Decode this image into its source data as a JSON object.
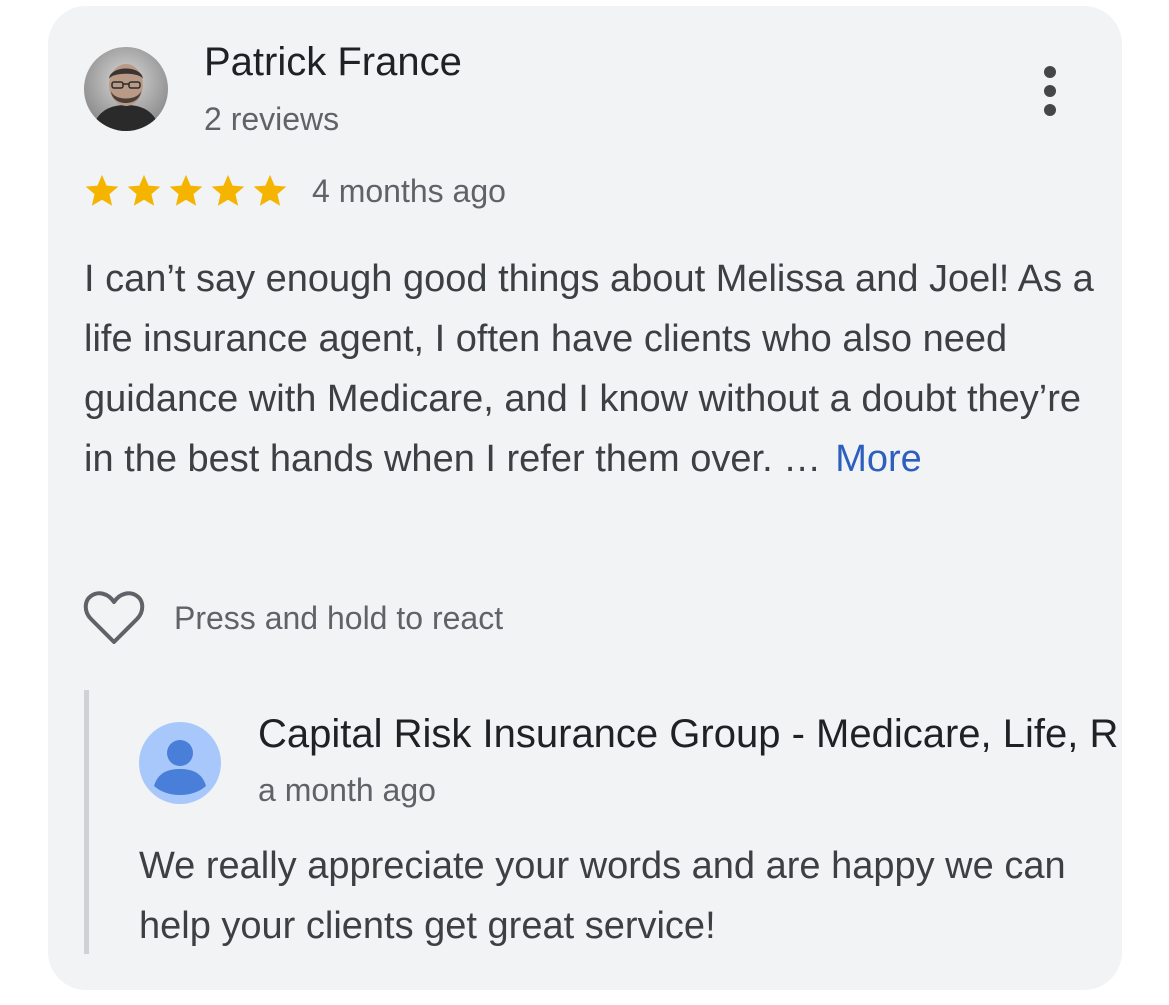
{
  "review": {
    "reviewer_name": "Patrick France",
    "reviewer_meta": "2 reviews",
    "rating": 5,
    "rating_max": 5,
    "timestamp": "4 months ago",
    "body_text": "I can’t say enough good things about Melissa and Joel! As a life insurance agent, I often have clients who also need guidance with Medicare, and I know without a doubt they’re in the best hands when I refer them over. …",
    "more_label": "More",
    "react_label": "Press and hold to react"
  },
  "reply": {
    "owner_name": "Capital Risk Insurance Group - Medicare, Life, R",
    "timestamp": "a month ago",
    "body_text": "We really appreciate your words and are happy we can help your clients get great service!"
  },
  "icons": {
    "avatar": "reviewer-avatar-photo",
    "menu": "more-vert-icon",
    "star": "star-icon",
    "heart": "heart-outline-icon",
    "owner_avatar": "person-icon"
  },
  "colors": {
    "card_bg": "#f2f3f5",
    "star": "#f5b400",
    "link": "#2c5fbf",
    "owner_avatar_bg": "#a8c7fa",
    "owner_avatar_fg": "#4a7fd9"
  }
}
